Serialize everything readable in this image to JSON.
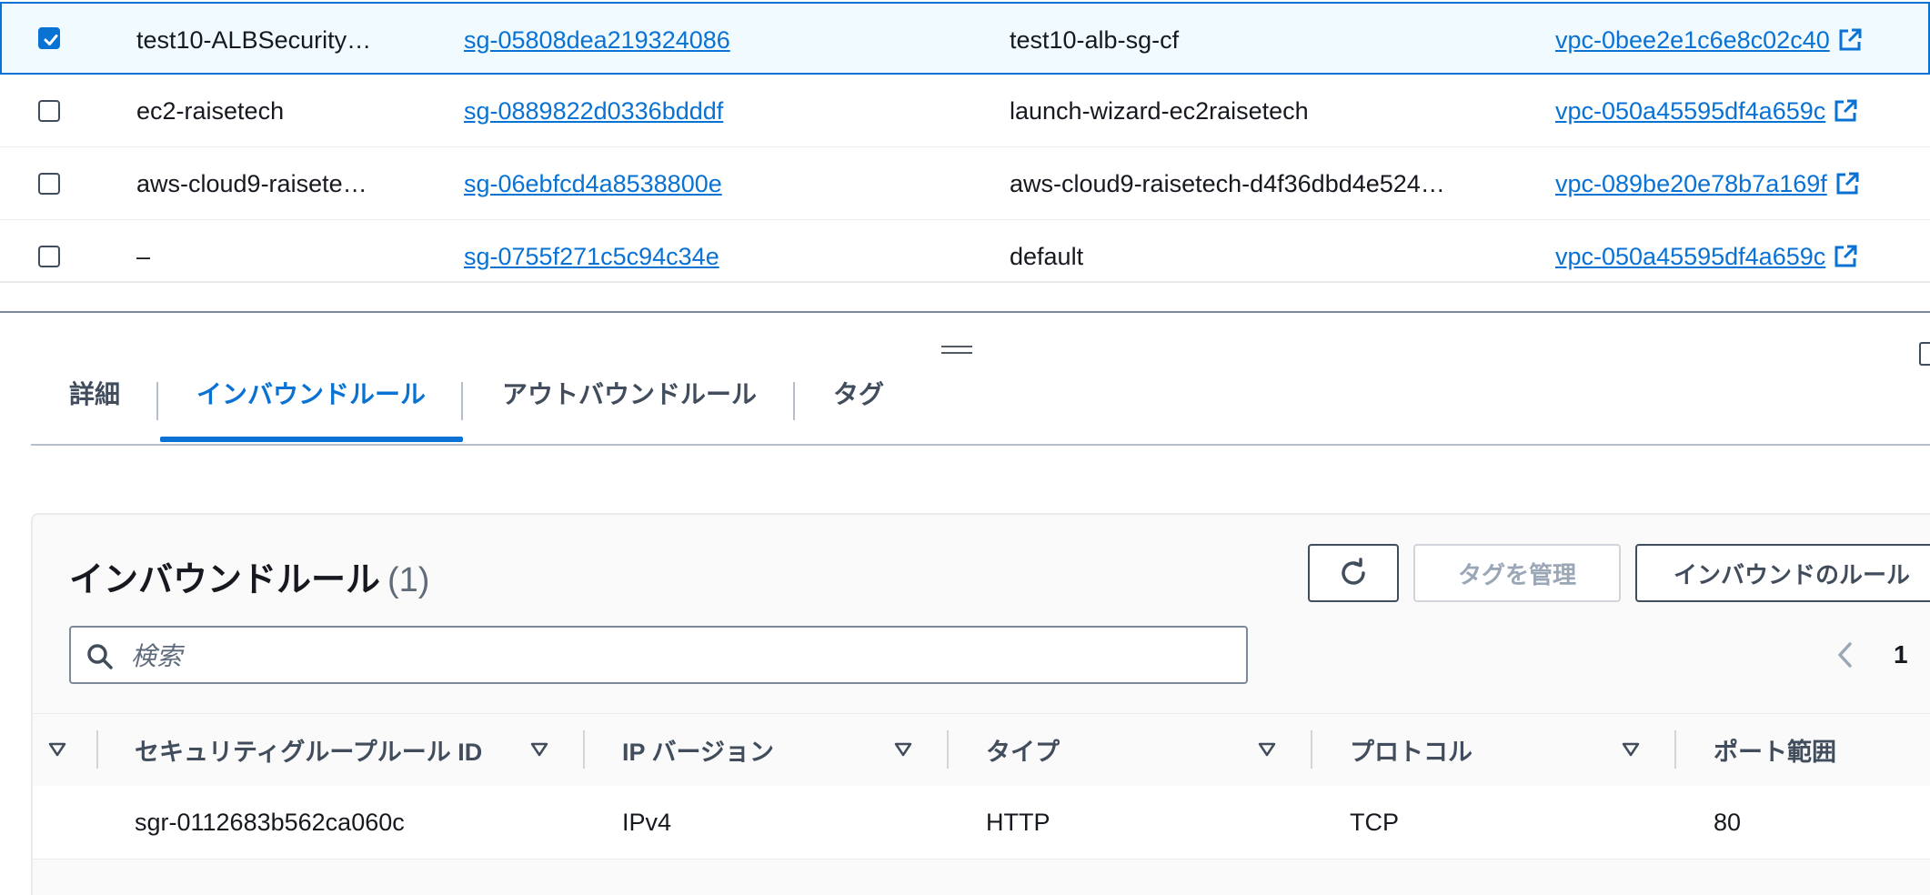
{
  "security_groups": [
    {
      "selected": true,
      "name": "test10-ALBSecurity…",
      "group_id": "sg-05808dea219324086",
      "group_name": "test10-alb-sg-cf",
      "vpc_id": "vpc-0bee2e1c6e8c02c40"
    },
    {
      "selected": false,
      "name": "ec2-raisetech",
      "group_id": "sg-0889822d0336bdddf",
      "group_name": "launch-wizard-ec2raisetech",
      "vpc_id": "vpc-050a45595df4a659c"
    },
    {
      "selected": false,
      "name": "aws-cloud9-raisete…",
      "group_id": "sg-06ebfcd4a8538800e",
      "group_name": "aws-cloud9-raisetech-d4f36dbd4e524…",
      "vpc_id": "vpc-089be20e78b7a169f"
    },
    {
      "selected": false,
      "name": "–",
      "group_id": "sg-0755f271c5c94c34e",
      "group_name": "default",
      "vpc_id": "vpc-050a45595df4a659c"
    }
  ],
  "tabs": [
    {
      "label": "詳細"
    },
    {
      "label": "インバウンドルール",
      "active": true
    },
    {
      "label": "アウトバウンドルール"
    },
    {
      "label": "タグ"
    }
  ],
  "inbound": {
    "title": "インバウンドルール",
    "count": "(1)",
    "manage_tags_label": "タグを管理",
    "edit_rules_label": "インバウンドのルール",
    "search_placeholder": "検索",
    "page_number": "1",
    "columns": [
      "セキュリティグループルール ID",
      "IP バージョン",
      "タイプ",
      "プロトコル",
      "ポート範囲"
    ],
    "rows": [
      {
        "rule_id": "sgr-0112683b562ca060c",
        "ip_version": "IPv4",
        "type": "HTTP",
        "protocol": "TCP",
        "port_range": "80"
      }
    ]
  },
  "colors": {
    "accent": "#0972d3",
    "text": "#16191f",
    "muted": "#5f6b7a",
    "selected_row_bg": "#f1faff"
  }
}
